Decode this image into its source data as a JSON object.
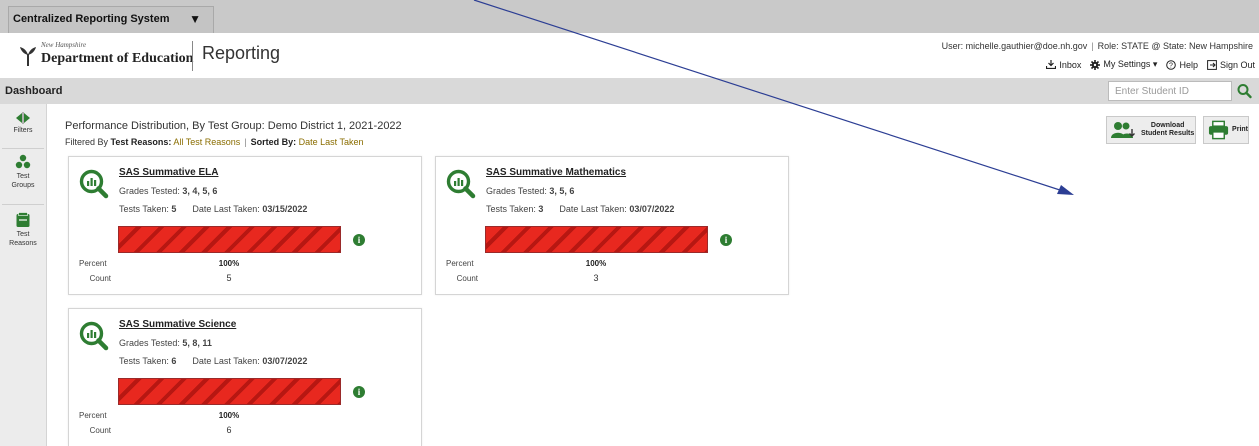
{
  "system_bar": {
    "selector_label": "Centralized Reporting System"
  },
  "header": {
    "logo_state": "New Hampshire",
    "logo_org": "Department of Education",
    "app_title": "Reporting",
    "user_label": "User: michelle.gauthier@doe.nh.gov",
    "role_label": "Role: STATE @ State: New Hampshire",
    "links": {
      "inbox": "Inbox",
      "settings": "My Settings ▾",
      "help": "Help",
      "signout": "Sign Out"
    }
  },
  "dashboard": {
    "label": "Dashboard",
    "student_search": {
      "placeholder": "Enter Student ID",
      "value": ""
    }
  },
  "rail": {
    "filters": "Filters",
    "test_groups_1": "Test",
    "test_groups_2": "Groups",
    "test_reasons_1": "Test",
    "test_reasons_2": "Reasons"
  },
  "content": {
    "title": "Performance Distribution, By Test Group: Demo District 1, 2021-2022",
    "filtered_by_label": "Filtered By",
    "test_reasons_label": "Test Reasons:",
    "test_reasons_value": "All Test Reasons",
    "sorted_by_label": "Sorted By:",
    "sorted_by_value": "Date Last Taken",
    "download_line1": "Download",
    "download_line2": "Student Results",
    "print_label": "Print"
  },
  "cards": [
    {
      "title": "SAS Summative ELA",
      "grades_label": "Grades Tested:",
      "grades": "3, 4, 5, 6",
      "tests_label": "Tests Taken:",
      "tests": "5",
      "date_label": "Date Last Taken:",
      "date": "03/15/2022",
      "percent_label": "Percent",
      "count_label": "Count",
      "percent": "100%",
      "count": "5"
    },
    {
      "title": "SAS Summative Mathematics",
      "grades_label": "Grades Tested:",
      "grades": "3, 5, 6",
      "tests_label": "Tests Taken:",
      "tests": "3",
      "date_label": "Date Last Taken:",
      "date": "03/07/2022",
      "percent_label": "Percent",
      "count_label": "Count",
      "percent": "100%",
      "count": "3"
    },
    {
      "title": "SAS Summative Science",
      "grades_label": "Grades Tested:",
      "grades": "5, 8, 11",
      "tests_label": "Tests Taken:",
      "tests": "6",
      "date_label": "Date Last Taken:",
      "date": "03/07/2022",
      "percent_label": "Percent",
      "count_label": "Count",
      "percent": "100%",
      "count": "6"
    }
  ],
  "colors": {
    "bar_red": "#e8281f",
    "icon_green": "#2e7d32",
    "arrow_blue": "#2c3e94"
  }
}
